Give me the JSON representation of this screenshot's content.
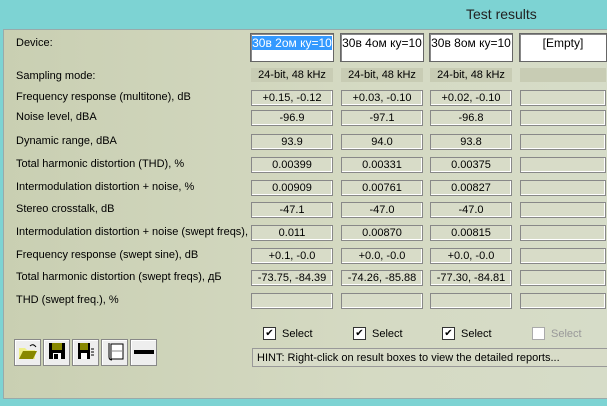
{
  "title": "Test results",
  "device_label": "Device:",
  "devices": [
    "30в 2ом ку=10",
    "30в 4ом ку=10",
    "30в 8ом ку=10",
    "[Empty]"
  ],
  "sampling": {
    "label": "Sampling mode:",
    "values": [
      "24-bit, 48 kHz",
      "24-bit, 48 kHz",
      "24-bit, 48 kHz",
      ""
    ]
  },
  "rows": [
    {
      "label": "Frequency response (multitone), dB",
      "values": [
        "+0.15, -0.12",
        "+0.03, -0.10",
        "+0.02, -0.10",
        ""
      ]
    },
    {
      "label": "Noise level, dBA",
      "values": [
        "-96.9",
        "-97.1",
        "-96.8",
        ""
      ]
    },
    {
      "label": "Dynamic range, dBA",
      "values": [
        "93.9",
        "94.0",
        "93.8",
        ""
      ]
    },
    {
      "label": "Total harmonic distortion (THD), %",
      "values": [
        "0.00399",
        "0.00331",
        "0.00375",
        ""
      ]
    },
    {
      "label": "Intermodulation distortion + noise, %",
      "values": [
        "0.00909",
        "0.00761",
        "0.00827",
        ""
      ]
    },
    {
      "label": "Stereo crosstalk, dB",
      "values": [
        "-47.1",
        "-47.0",
        "-47.0",
        ""
      ]
    },
    {
      "label": "Intermodulation distortion + noise (swept freqs), %",
      "values": [
        "0.011",
        "0.00870",
        "0.00815",
        ""
      ]
    },
    {
      "label": "Frequency response (swept sine), dB",
      "values": [
        "+0.1, -0.0",
        "+0.0, -0.0",
        "+0.0, -0.0",
        ""
      ]
    },
    {
      "label": "Total harmonic distortion (swept freqs), дБ",
      "values": [
        "-73.75, -84.39",
        "-74.26, -85.88",
        "-77.30, -84.81",
        ""
      ]
    },
    {
      "label": "THD (swept freq.), %",
      "values": [
        "",
        "",
        "",
        ""
      ]
    }
  ],
  "select": [
    {
      "label": "Select",
      "checked": true
    },
    {
      "label": "Select",
      "checked": true
    },
    {
      "label": "Select",
      "checked": true
    },
    {
      "label": "Select",
      "checked": false
    }
  ],
  "hint": "HINT: Right-click on result boxes to view the detailed reports...",
  "toolbar": [
    "open-icon",
    "save-icon",
    "save-report-icon",
    "copy-icon",
    "remove-icon"
  ]
}
